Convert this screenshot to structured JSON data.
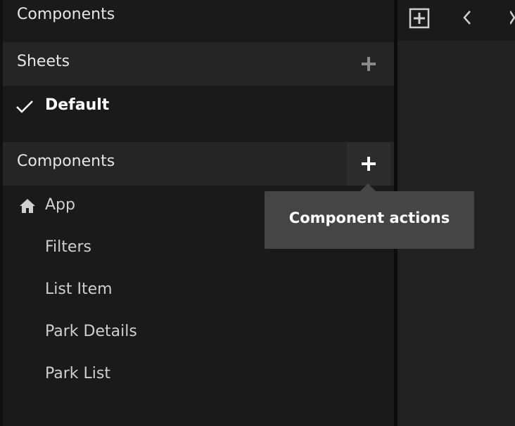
{
  "panel": {
    "title": "Components"
  },
  "sheets": {
    "header": "Sheets",
    "add_icon": "plus-icon",
    "items": [
      {
        "label": "Default",
        "selected": true
      }
    ]
  },
  "components": {
    "header": "Components",
    "add_icon": "plus-icon",
    "items": [
      {
        "label": "App",
        "icon": "home-icon"
      },
      {
        "label": "Filters"
      },
      {
        "label": "List Item"
      },
      {
        "label": "Park Details"
      },
      {
        "label": "Park List"
      }
    ]
  },
  "tooltip": {
    "text": "Component actions"
  },
  "toolbar": {
    "icons": [
      "add-square-icon",
      "chevron-left-icon",
      "chevron-right-icon"
    ]
  },
  "colors": {
    "background": "#1a1a1a",
    "header": "#252525",
    "tooltip": "#454545"
  }
}
